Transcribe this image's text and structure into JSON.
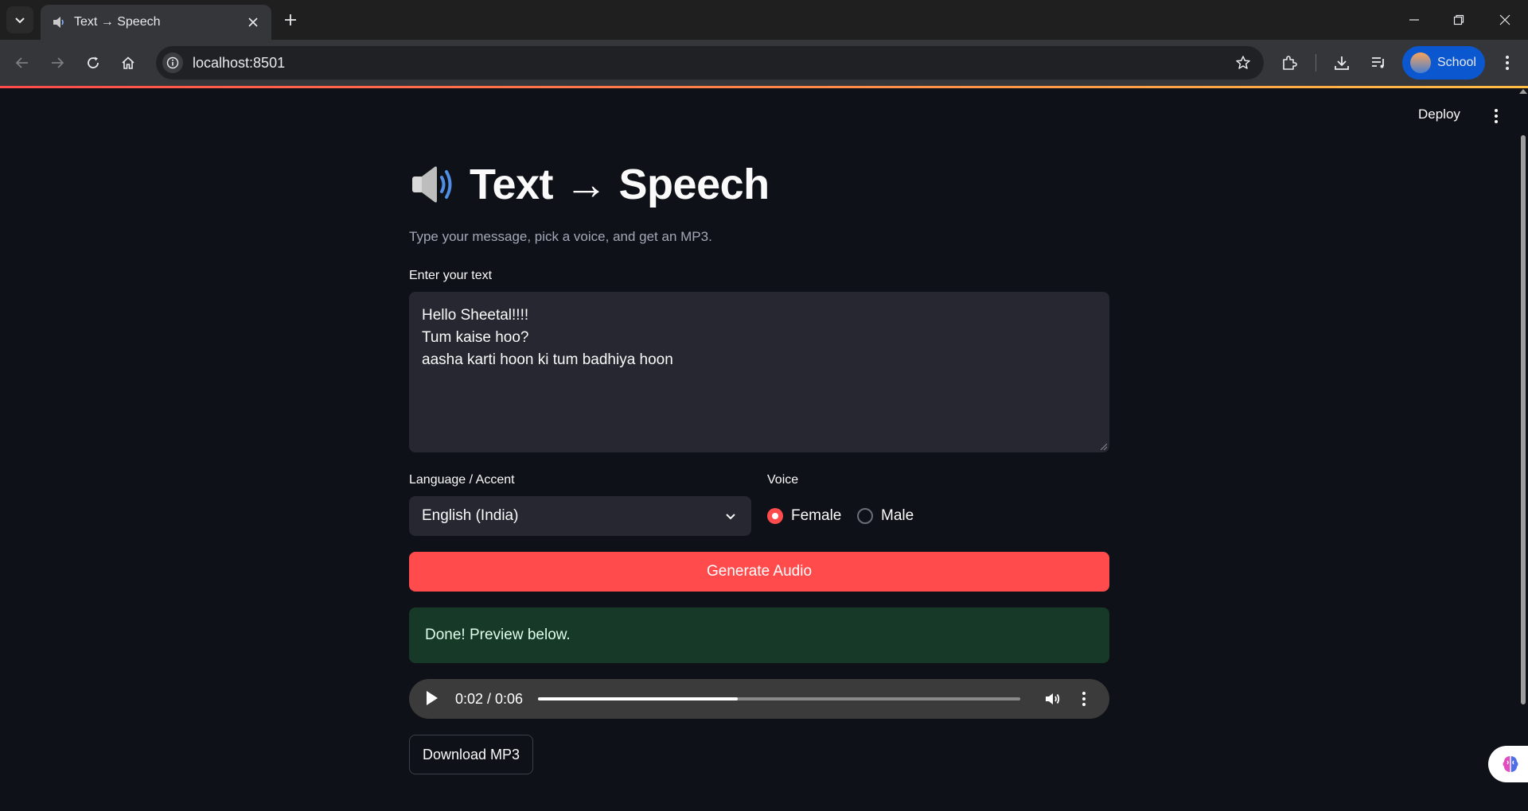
{
  "browser": {
    "tab_title": "Text → Speech",
    "url": "localhost:8501",
    "profile_name": "School"
  },
  "app": {
    "deploy_label": "Deploy",
    "title": "Text → Speech",
    "caption": "Type your message, pick a voice, and get an MP3.",
    "text_input": {
      "label": "Enter your text",
      "lines": [
        "Hello Sheetal!!!!",
        "Tum kaise hoo?",
        "aasha karti hoon ki tum badhiya hoon"
      ]
    },
    "language": {
      "label": "Language / Accent",
      "selected": "English (India)"
    },
    "voice": {
      "label": "Voice",
      "options": [
        "Female",
        "Male"
      ],
      "selected": "Female"
    },
    "generate_label": "Generate Audio",
    "success_message": "Done! Preview below.",
    "audio": {
      "time_display": "0:02 / 0:06",
      "progress": 0.415
    },
    "download_label": "Download MP3"
  },
  "colors": {
    "primary": "#ff4b4b",
    "background": "#0e1117",
    "widget_bg": "#262730",
    "success_bg": "#173928"
  }
}
